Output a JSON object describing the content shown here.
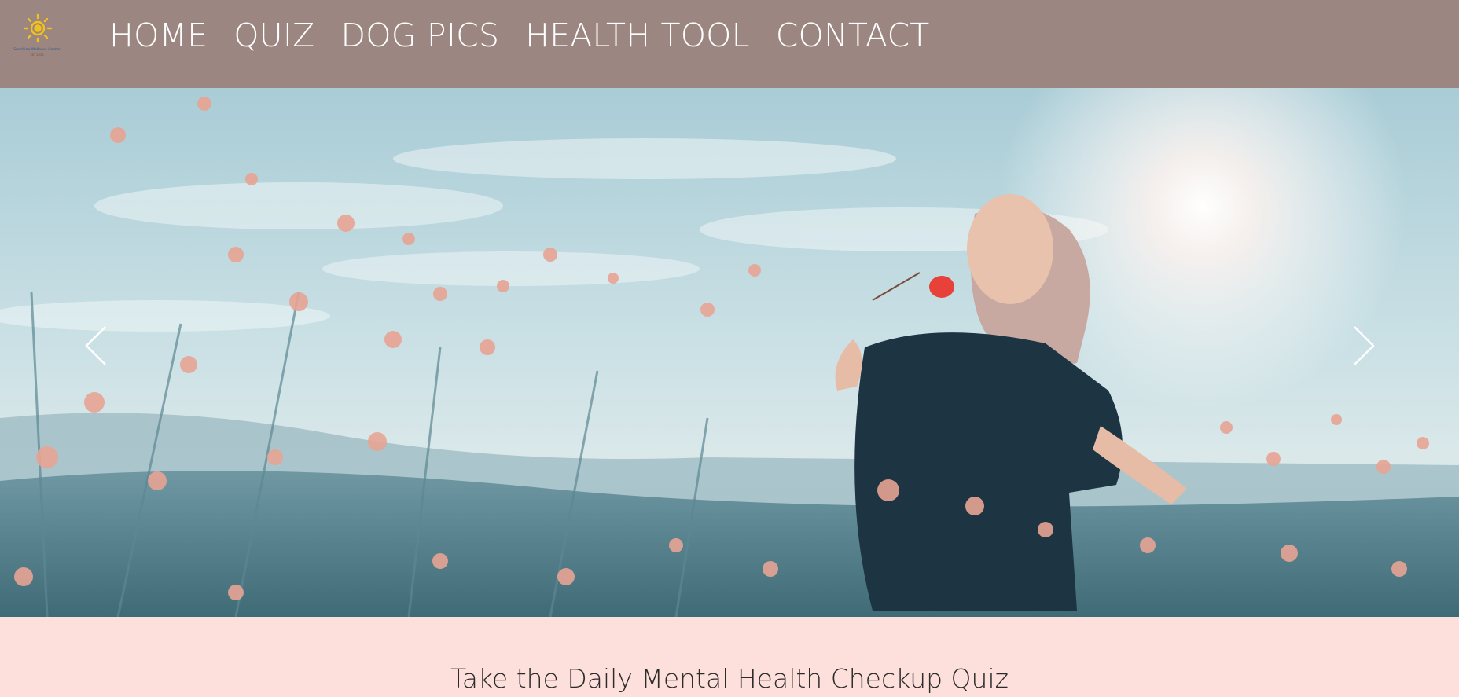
{
  "logo": {
    "icon": "sun-icon",
    "org_name": "Sunshine Wellness Center",
    "tagline": "EST 2019"
  },
  "nav": {
    "items": [
      {
        "label": "HOME"
      },
      {
        "label": "QUIZ"
      },
      {
        "label": "DOG PICS"
      },
      {
        "label": "HEALTH TOOL"
      },
      {
        "label": "CONTACT"
      }
    ]
  },
  "carousel": {
    "prev_icon": "chevron-left-icon",
    "next_icon": "chevron-right-icon"
  },
  "main": {
    "quiz_heading": "Take the Daily Mental Health Checkup Quiz"
  },
  "colors": {
    "navbar_bg": "#9b8681",
    "nav_text": "#ffffff",
    "page_bg": "#fde0dc",
    "logo_sun": "#f2c21b"
  }
}
